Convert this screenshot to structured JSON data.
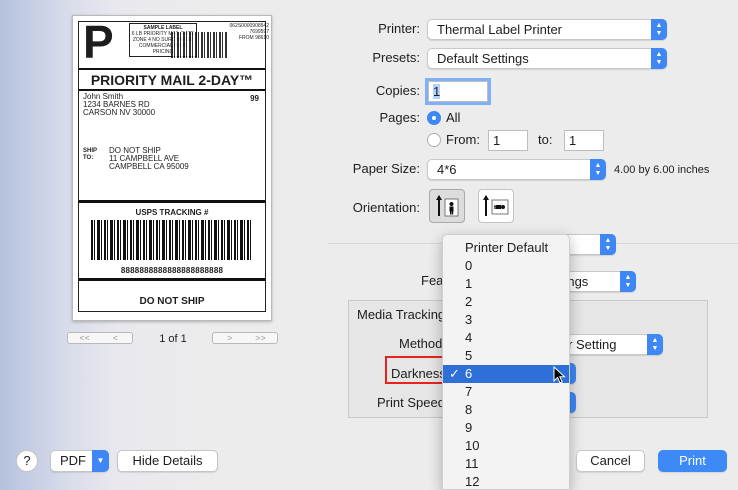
{
  "preview": {
    "service_letter": "P",
    "sample_box": [
      "SAMPLE LABEL",
      "6 LB PRIORITY MAIL RATE",
      "ZONE 4 NO SURCHARGE",
      "COMMERCIAL PLUS PRICING"
    ],
    "postage_box": [
      "062S0000908542",
      "7699597",
      "FROM 98610"
    ],
    "service_title": "PRIORITY MAIL 2-DAY™",
    "from_lines": [
      "John Smith",
      "1234 BARNES RD",
      "CARSON NV 30000"
    ],
    "zone": "99",
    "ship_to_label": [
      "SHIP",
      "TO:"
    ],
    "to_lines": [
      "DO NOT SHIP",
      "11 CAMPBELL AVE",
      "CAMPBELL CA 95009"
    ],
    "tracking_heading": "USPS TRACKING #",
    "tracking_number": "8888888888888888888888",
    "footer": "DO NOT SHIP"
  },
  "pager": {
    "first": "<<",
    "prev": "<",
    "next": ">",
    "last": ">>",
    "text": "1 of 1"
  },
  "form": {
    "printer_label": "Printer:",
    "printer_value": "Thermal Label Printer",
    "presets_label": "Presets:",
    "presets_value": "Default Settings",
    "copies_label": "Copies:",
    "copies_value": "1",
    "pages_label": "Pages:",
    "pages_all": "All",
    "pages_from": "From:",
    "from_value": "1",
    "to_label": "to:",
    "to_value": "1",
    "paper_size_label": "Paper Size:",
    "paper_size_value": "4*6",
    "paper_size_dims": "4.00 by 6.00 inches",
    "orientation_label": "Orientation:"
  },
  "features": {
    "label_partial": "Fea",
    "value_partial": "ettings",
    "group_title": "Media Tracking",
    "method_label": "Method",
    "method_value_partial": "nter Setting",
    "darkness_label": "Darkness",
    "print_speed_label": "Print Speed"
  },
  "menu": {
    "items": [
      "Printer Default",
      "0",
      "1",
      "2",
      "3",
      "4",
      "5",
      "6",
      "7",
      "8",
      "9",
      "10",
      "11",
      "12"
    ],
    "selected": "6",
    "check": "✓"
  },
  "bottom": {
    "help": "?",
    "pdf": "PDF",
    "hide_details": "Hide Details",
    "cancel": "Cancel",
    "print": "Print"
  },
  "colors": {
    "accent": "#3d8af7",
    "highlight": "#2e6fd8",
    "annotation": "#e8231d"
  }
}
